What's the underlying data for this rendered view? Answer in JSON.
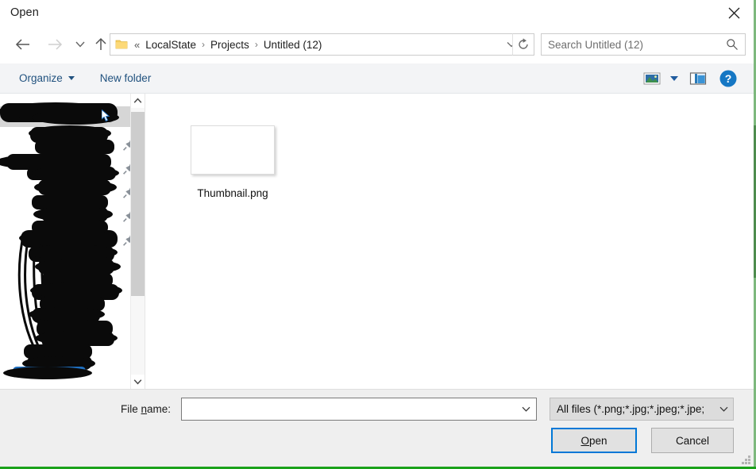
{
  "window": {
    "title": "Open",
    "close_label": "close-icon"
  },
  "navigation": {
    "back": "back-arrow",
    "forward": "forward-arrow",
    "recent": "recent-locations-chevron",
    "up": "up-arrow"
  },
  "breadcrumb": {
    "folder_icon": "folder-icon",
    "overflow": "«",
    "separator": "›",
    "items": [
      "LocalState",
      "Projects",
      "Untitled (12)"
    ]
  },
  "address": {
    "dropdown_icon": "chevron-down-icon",
    "refresh_icon": "refresh-icon"
  },
  "search": {
    "placeholder": "Search Untitled (12)",
    "icon": "search-icon"
  },
  "toolbar": {
    "organize_label": "Organize",
    "new_folder_label": "New folder",
    "view_icon": "view-layout-icon",
    "view_caret_icon": "chevron-down-icon",
    "preview_pane_icon": "preview-pane-icon",
    "help_icon": "help-icon"
  },
  "navpane": {
    "redacted": true,
    "pin_count": 5,
    "pin_icon": "pushpin-icon",
    "scroll_up_icon": "scroll-up-arrow",
    "scroll_down_icon": "scroll-down-arrow"
  },
  "content": {
    "files": [
      {
        "name": "Thumbnail.png",
        "type": "image",
        "thumbnail": "blank-white-preview"
      }
    ]
  },
  "footer": {
    "filename_label_pre": "File ",
    "filename_label_accel": "n",
    "filename_label_post": "ame:",
    "filename_value": "",
    "filename_caret_icon": "chevron-down-icon",
    "filetype_value": "All files (*.png;*.jpg;*.jpeg;*.jpe;",
    "filetype_caret_icon": "chevron-down-icon",
    "open_button_accel": "O",
    "open_button_rest": "pen",
    "cancel_button_label": "Cancel",
    "resize_grip": "resize-grip"
  },
  "colors": {
    "accent": "#0078d7",
    "toolbar_link": "#21527f",
    "toolbar_bg": "#f3f4f6",
    "footer_bg": "#efefef",
    "capture_border": "#1aa11a",
    "nav_highlight": "#d6d6d6"
  }
}
